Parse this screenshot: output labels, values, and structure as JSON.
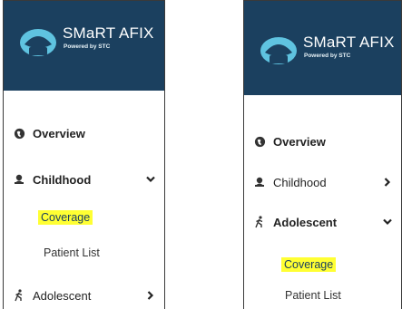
{
  "brand": {
    "title": "SMaRT AFIX",
    "subtitle": "Powered by STC",
    "header_color": "#1b405f",
    "logo_color": "#5fc3e0",
    "highlight_color": "#ffff33"
  },
  "left_panel": {
    "nav": [
      {
        "icon": "globe-icon",
        "label": "Overview",
        "bold": true
      },
      {
        "icon": "user-icon",
        "label": "Childhood",
        "bold": true,
        "chevron": "chevron-down-icon"
      },
      {
        "icon": "running-person-icon",
        "label": "Adolescent",
        "bold": false,
        "chevron": "chevron-right-icon"
      }
    ],
    "subitems": [
      {
        "label": "Coverage",
        "highlighted": true
      },
      {
        "label": "Patient List",
        "highlighted": false
      }
    ]
  },
  "right_panel": {
    "nav": [
      {
        "icon": "globe-icon",
        "label": "Overview",
        "bold": true
      },
      {
        "icon": "user-icon",
        "label": "Childhood",
        "bold": false,
        "chevron": "chevron-right-icon"
      },
      {
        "icon": "running-person-icon",
        "label": "Adolescent",
        "bold": true,
        "chevron": "chevron-down-icon"
      }
    ],
    "subitems": [
      {
        "label": "Coverage",
        "highlighted": true
      },
      {
        "label": "Patient List",
        "highlighted": false
      }
    ]
  }
}
